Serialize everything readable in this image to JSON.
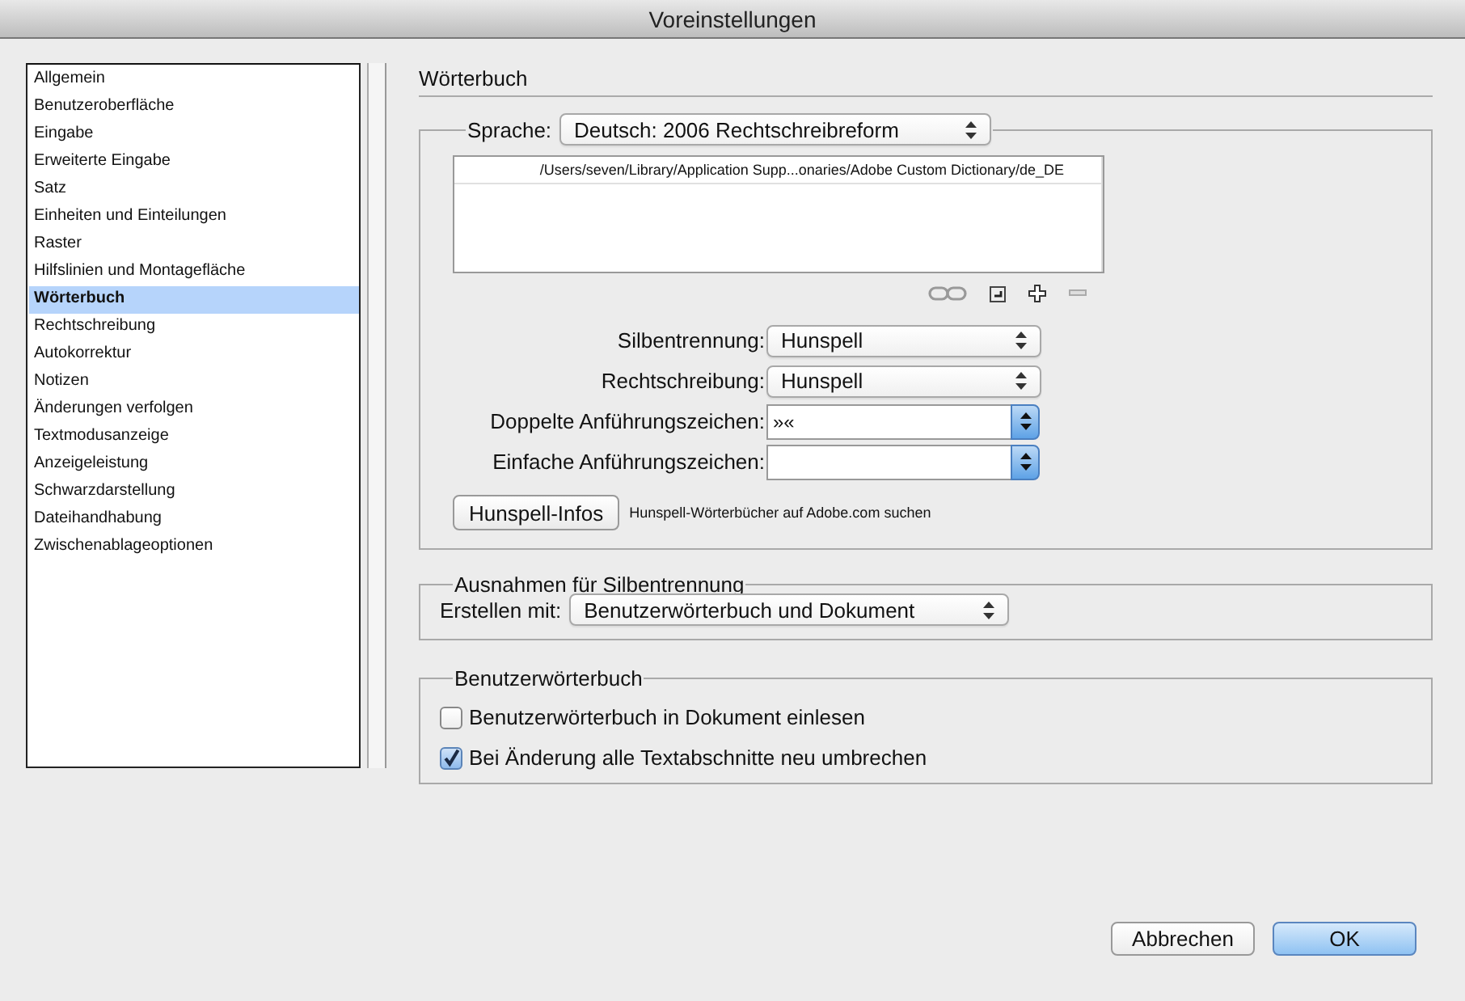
{
  "window": {
    "title": "Voreinstellungen"
  },
  "sidebar": {
    "items": [
      {
        "label": "Allgemein",
        "selected": false
      },
      {
        "label": "Benutzeroberfläche",
        "selected": false
      },
      {
        "label": "Eingabe",
        "selected": false
      },
      {
        "label": "Erweiterte Eingabe",
        "selected": false
      },
      {
        "label": "Satz",
        "selected": false
      },
      {
        "label": "Einheiten und Einteilungen",
        "selected": false
      },
      {
        "label": "Raster",
        "selected": false
      },
      {
        "label": "Hilfslinien und Montagefläche",
        "selected": false
      },
      {
        "label": "Wörterbuch",
        "selected": true
      },
      {
        "label": "Rechtschreibung",
        "selected": false
      },
      {
        "label": "Autokorrektur",
        "selected": false
      },
      {
        "label": "Notizen",
        "selected": false
      },
      {
        "label": "Änderungen verfolgen",
        "selected": false
      },
      {
        "label": "Textmodusanzeige",
        "selected": false
      },
      {
        "label": "Anzeigeleistung",
        "selected": false
      },
      {
        "label": "Schwarzdarstellung",
        "selected": false
      },
      {
        "label": "Dateihandhabung",
        "selected": false
      },
      {
        "label": "Zwischenablageoptionen",
        "selected": false
      }
    ]
  },
  "section_title": "Wörterbuch",
  "language": {
    "label": "Sprache:",
    "value": "Deutsch: 2006 Rechtschreibreform"
  },
  "dictionary_list": {
    "rows": [
      "/Users/seven/Library/Application Supp...onaries/Adobe Custom Dictionary/de_DE"
    ]
  },
  "fields": [
    {
      "kind": "select",
      "label": "Silbentrennung:",
      "value": "Hunspell"
    },
    {
      "kind": "select",
      "label": "Rechtschreibung:",
      "value": "Hunspell"
    },
    {
      "kind": "combo",
      "label": "Doppelte Anführungszeichen:",
      "value": "»«"
    },
    {
      "kind": "combo",
      "label": "Einfache Anführungszeichen:"
    }
  ],
  "hunspell": {
    "button": "Hunspell-Infos",
    "link": "Hunspell-Wörterbücher auf Adobe.com suchen"
  },
  "hyphenation_exceptions": {
    "title": "Ausnahmen für Silbentrennung",
    "label": "Erstellen mit:",
    "value": "Benutzerwörterbuch und Dokument"
  },
  "user_dictionary": {
    "title": "Benutzerwörterbuch",
    "options": [
      {
        "label": "Benutzerwörterbuch in Dokument einlesen",
        "checked": false
      },
      {
        "label": "Bei Änderung alle Textabschnitte neu umbrechen",
        "checked": true
      }
    ]
  },
  "buttons": [
    {
      "label": "Abbrechen",
      "default": false
    },
    {
      "label": "OK",
      "default": true
    }
  ]
}
